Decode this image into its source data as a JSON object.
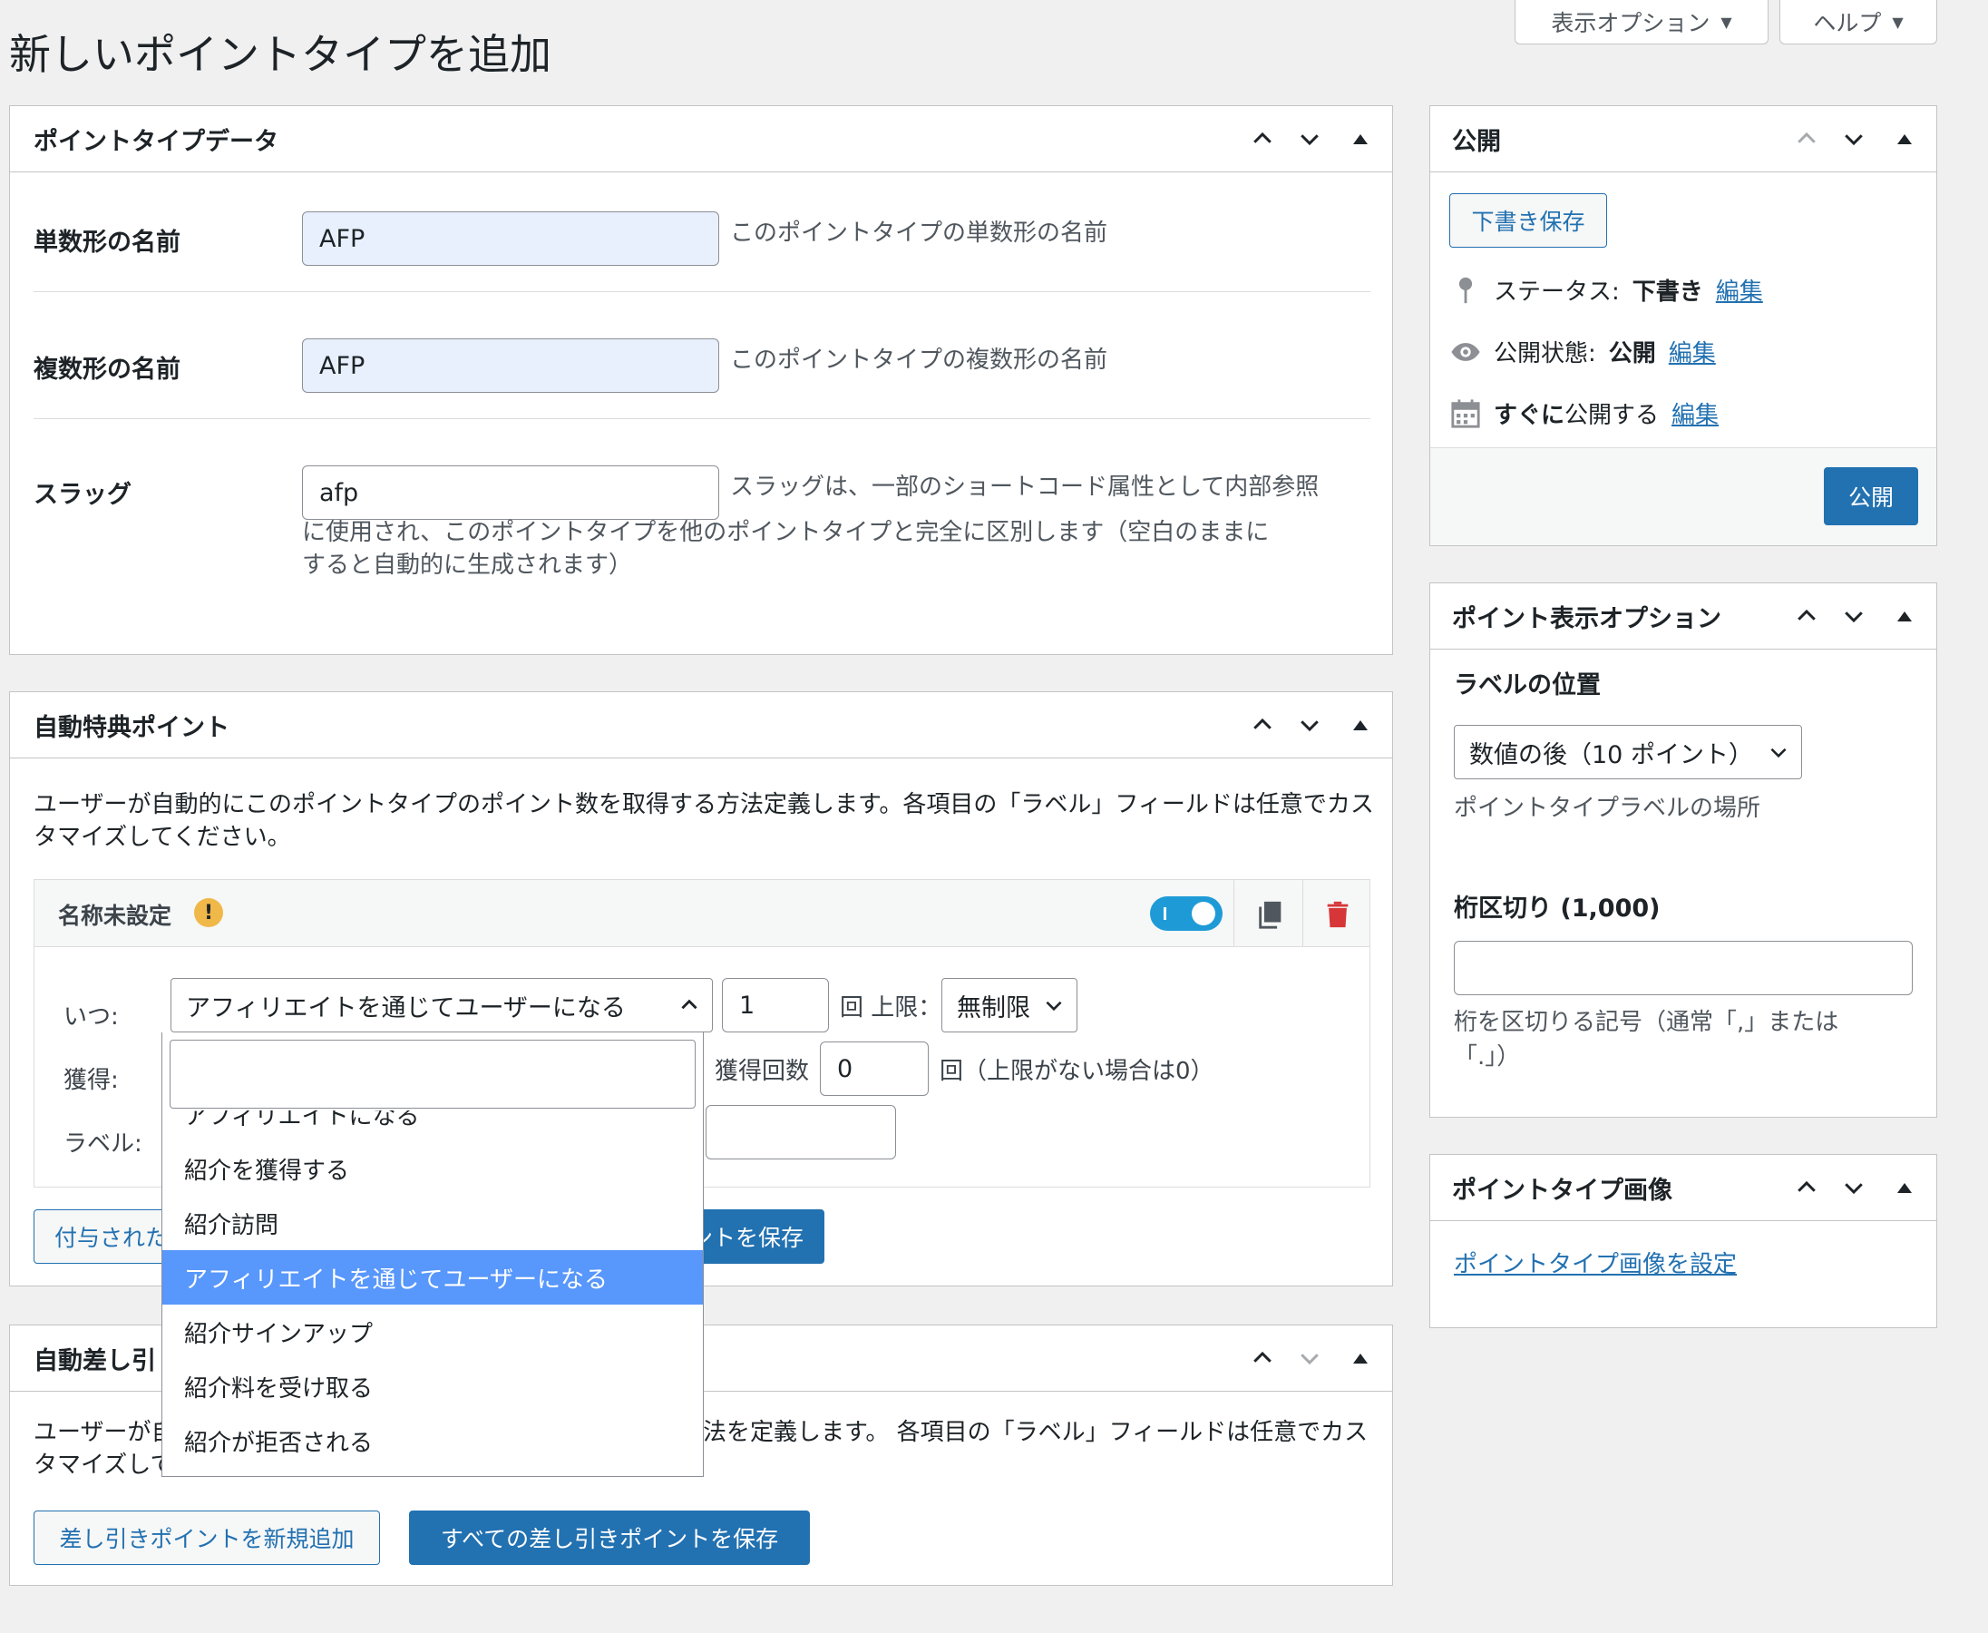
{
  "page": {
    "title": "新しいポイントタイプを追加"
  },
  "screen_meta": {
    "screen_options": "表示オプション",
    "help": "ヘルプ"
  },
  "point_type_data": {
    "title": "ポイントタイプデータ",
    "singular": {
      "label": "単数形の名前",
      "value": "AFP",
      "hint": "このポイントタイプの単数形の名前"
    },
    "plural": {
      "label": "複数形の名前",
      "value": "AFP",
      "hint": "このポイントタイプの複数形の名前"
    },
    "slug": {
      "label": "スラッグ",
      "value": "afp",
      "hint_line1": "スラッグは、一部のショートコード属性として内部参照",
      "hint_line2": "に使用され、このポイントタイプを他のポイントタイプと完全に区別します（空白のままに",
      "hint_line3": "すると自動的に生成されます）"
    }
  },
  "auto_award": {
    "title": "自動特典ポイント",
    "description_line1": "ユーザーが自動的にこのポイントタイプのポイント数を取得する方法定義します。各項目の「ラベル」フィールドは任意でカス",
    "description_line2": "タマイズしてください。",
    "item": {
      "name": "名称未設定",
      "warning": "!",
      "when_label": "いつ:",
      "when_value": "アフィリエイトを通じてユーザーになる",
      "times_value": "1",
      "times_suffix": "回 上限：",
      "limit_value": "無制限",
      "earn_label": "獲得:",
      "earn_count_label": "獲得回数",
      "earn_count_value": "0",
      "earn_count_suffix": "回（上限がない場合は0）",
      "label_label": "ラベル:"
    },
    "add_button": "付与された",
    "save_button": "ントを保存"
  },
  "dropdown": {
    "options": [
      "アフィリエイトになる",
      "紹介を獲得する",
      "紹介訪問",
      "アフィリエイトを通じてユーザーになる",
      "紹介サインアップ",
      "紹介料を受け取る",
      "紹介が拒否される"
    ],
    "selected_index": 3
  },
  "auto_deduct": {
    "title": "自動差し引",
    "description_line1_a": "ユーザーが自",
    "description_line1_b": "法を定義します。 各項目の「ラベル」フィールドは任意でカス",
    "description_line2": "タマイズして",
    "add_button": "差し引きポイントを新規追加",
    "save_button": "すべての差し引きポイントを保存"
  },
  "publish": {
    "title": "公開",
    "save_draft": "下書き保存",
    "status_label": "ステータス: ",
    "status_value": "下書き",
    "visibility_label": "公開状態: ",
    "visibility_value": "公開",
    "schedule_bold": "すぐに",
    "schedule_text": "公開する",
    "edit": "編集",
    "publish_button": "公開"
  },
  "display_options": {
    "title": "ポイント表示オプション",
    "label_position": "ラベルの位置",
    "label_position_value": "数値の後（10 ポイント）",
    "label_position_hint": "ポイントタイプラベルの場所",
    "separator_label": "桁区切り (1,000)",
    "separator_value": "",
    "separator_hint_line1": "桁を区切りる記号（通常「,」または",
    "separator_hint_line2": "「.」）"
  },
  "point_image": {
    "title": "ポイントタイプ画像",
    "set_link": "ポイントタイプ画像を設定"
  }
}
